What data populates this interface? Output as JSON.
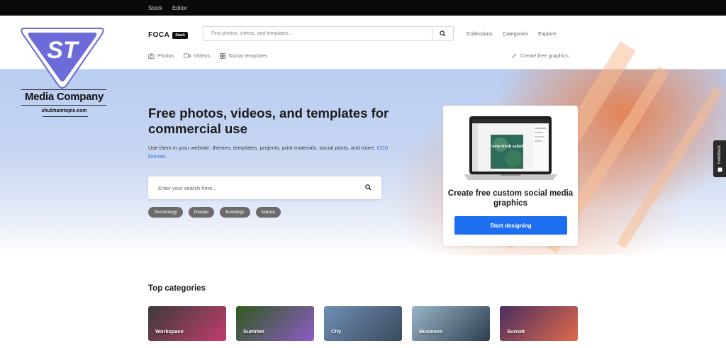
{
  "topbar": {
    "links": [
      "Stock",
      "Editor"
    ]
  },
  "logo": {
    "monogram": "ST",
    "name": "Media Company",
    "url": "shubhamtople.com"
  },
  "brand": {
    "name": "FOCA",
    "tag": "Stock"
  },
  "header_search": {
    "placeholder": "Find photos, videos, and templates..."
  },
  "nav": [
    "Collections",
    "Categories",
    "Explore"
  ],
  "subnav": {
    "items": [
      "Photos",
      "Videos",
      "Social templates"
    ],
    "create": "Create free graphics"
  },
  "hero": {
    "title": "Free photos, videos, and templates for commercial use",
    "description": "Use them in your website, themes, templates, projects, print materials, social posts, and more.",
    "license_link": "CC0 license",
    "search_placeholder": "Enter your search here...",
    "chips": [
      "Technology",
      "People",
      "Buildings",
      "Nature"
    ]
  },
  "promo": {
    "screen_text": "Farm fresh salads",
    "title": "Create free custom social media graphics",
    "button": "Start designing"
  },
  "feedback": {
    "label": "Feedback"
  },
  "categories": {
    "title": "Top categories",
    "items": [
      {
        "label": "Workspace",
        "colors": [
          "#3b3b3b",
          "#c23c6e"
        ]
      },
      {
        "label": "Summer",
        "colors": [
          "#2f5a1c",
          "#8e5cc6"
        ]
      },
      {
        "label": "City",
        "colors": [
          "#6f8fb5",
          "#3a4a5d"
        ]
      },
      {
        "label": "Business",
        "colors": [
          "#9ab5c8",
          "#2c3e50"
        ]
      },
      {
        "label": "Sunset",
        "colors": [
          "#4a2e5f",
          "#e06a4c"
        ]
      }
    ]
  }
}
